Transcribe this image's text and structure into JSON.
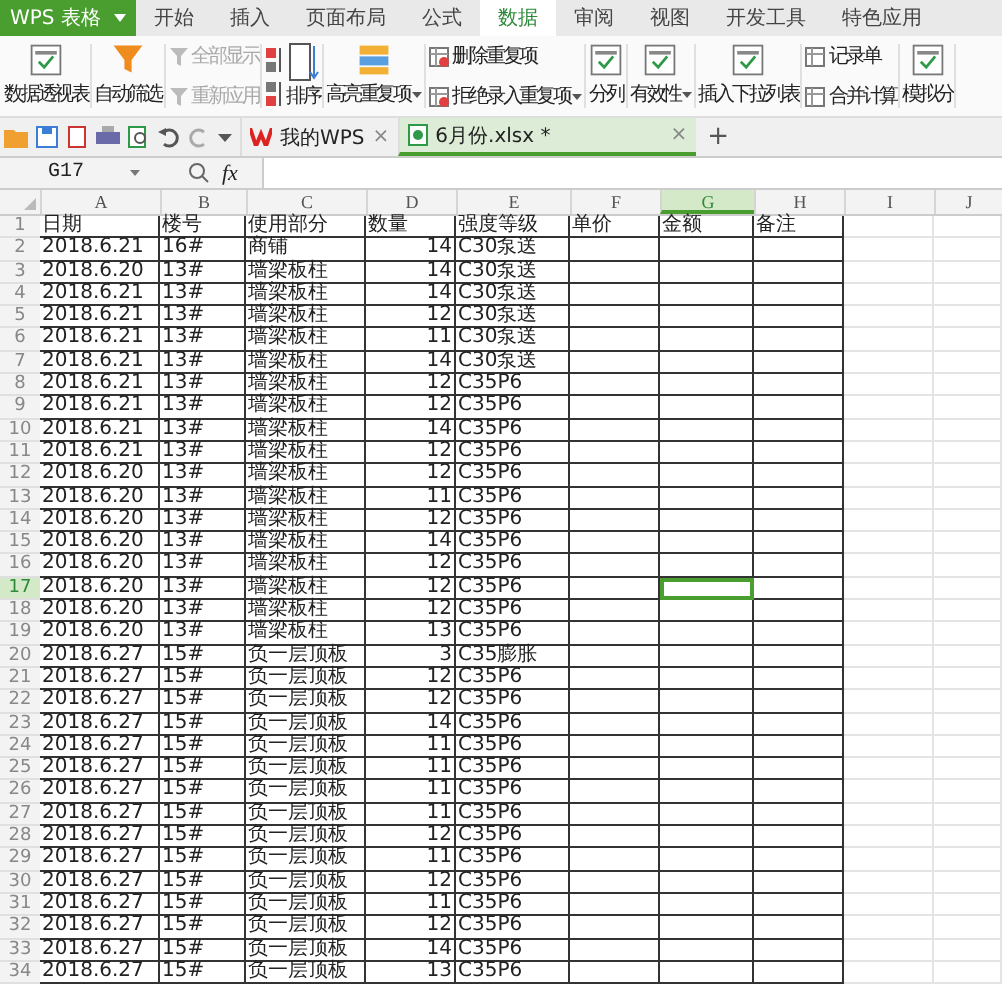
{
  "app": {
    "logo": "WPS 表格"
  },
  "menu_tabs": [
    {
      "label": "开始",
      "selected": false
    },
    {
      "label": "插入",
      "selected": false
    },
    {
      "label": "页面布局",
      "selected": false
    },
    {
      "label": "公式",
      "selected": false
    },
    {
      "label": "数据",
      "selected": true
    },
    {
      "label": "审阅",
      "selected": false
    },
    {
      "label": "视图",
      "selected": false
    },
    {
      "label": "开发工具",
      "selected": false
    },
    {
      "label": "特色应用",
      "selected": false
    }
  ],
  "ribbon": [
    {
      "kind": "large",
      "label": "数据透视表"
    },
    {
      "kind": "large",
      "label": "自动筛选"
    },
    {
      "kind": "stack",
      "items": [
        {
          "label": "全部显示",
          "disabled": true
        },
        {
          "label": "重新应用",
          "disabled": true
        }
      ]
    },
    {
      "kind": "sort",
      "label": "排序"
    },
    {
      "kind": "large",
      "label": "高亮重复项",
      "dropdown": true
    },
    {
      "kind": "stack",
      "items": [
        {
          "label": "删除重复项",
          "disabled": false,
          "dropdown": false
        },
        {
          "label": "拒绝录入重复项",
          "disabled": false,
          "dropdown": true
        }
      ]
    },
    {
      "kind": "large",
      "label": "分列",
      "dropdown": false
    },
    {
      "kind": "large",
      "label": "有效性",
      "dropdown": true
    },
    {
      "kind": "large",
      "label": "插入下拉列表",
      "dropdown": false
    },
    {
      "kind": "stack",
      "items": [
        {
          "label": "记录单",
          "disabled": false
        },
        {
          "label": "合并计算",
          "disabled": false
        }
      ]
    },
    {
      "kind": "large",
      "label": "模拟分"
    }
  ],
  "doc_tabs": [
    {
      "label": "我的WPS",
      "selected": false,
      "close": "×"
    },
    {
      "label": "6月份.xlsx *",
      "selected": true,
      "close": "×"
    }
  ],
  "new_tab": "+",
  "formula_bar": {
    "cell_ref": "G17",
    "fx": "fx"
  },
  "columns": [
    {
      "letter": "A",
      "selected": false
    },
    {
      "letter": "B",
      "selected": false
    },
    {
      "letter": "C",
      "selected": false
    },
    {
      "letter": "D",
      "selected": false
    },
    {
      "letter": "E",
      "selected": false
    },
    {
      "letter": "F",
      "selected": false
    },
    {
      "letter": "G",
      "selected": true
    },
    {
      "letter": "H",
      "selected": false
    },
    {
      "letter": "I",
      "selected": false
    },
    {
      "letter": "J",
      "selected": false
    }
  ],
  "rows": [
    {
      "number": "1",
      "selected": false,
      "cells": [
        "日期",
        "楼号",
        "使用部分",
        "数量",
        "强度等级",
        "单价",
        "金额",
        "备注"
      ]
    },
    {
      "number": "2",
      "selected": false,
      "cells": [
        "2018.6.21",
        "16#",
        "商铺",
        "14",
        "C30泵送"
      ]
    },
    {
      "number": "3",
      "selected": false,
      "cells": [
        "2018.6.20",
        "13#",
        "墙梁板柱",
        "14",
        "C30泵送"
      ]
    },
    {
      "number": "4",
      "selected": false,
      "cells": [
        "2018.6.21",
        "13#",
        "墙梁板柱",
        "14",
        "C30泵送"
      ]
    },
    {
      "number": "5",
      "selected": false,
      "cells": [
        "2018.6.21",
        "13#",
        "墙梁板柱",
        "12",
        "C30泵送"
      ]
    },
    {
      "number": "6",
      "selected": false,
      "cells": [
        "2018.6.21",
        "13#",
        "墙梁板柱",
        "11",
        "C30泵送"
      ]
    },
    {
      "number": "7",
      "selected": false,
      "cells": [
        "2018.6.21",
        "13#",
        "墙梁板柱",
        "14",
        "C30泵送"
      ]
    },
    {
      "number": "8",
      "selected": false,
      "cells": [
        "2018.6.21",
        "13#",
        "墙梁板柱",
        "12",
        "C35P6"
      ]
    },
    {
      "number": "9",
      "selected": false,
      "cells": [
        "2018.6.21",
        "13#",
        "墙梁板柱",
        "12",
        "C35P6"
      ]
    },
    {
      "number": "10",
      "selected": false,
      "cells": [
        "2018.6.21",
        "13#",
        "墙梁板柱",
        "14",
        "C35P6"
      ]
    },
    {
      "number": "11",
      "selected": false,
      "cells": [
        "2018.6.21",
        "13#",
        "墙梁板柱",
        "12",
        "C35P6"
      ]
    },
    {
      "number": "12",
      "selected": false,
      "cells": [
        "2018.6.20",
        "13#",
        "墙梁板柱",
        "12",
        "C35P6"
      ]
    },
    {
      "number": "13",
      "selected": false,
      "cells": [
        "2018.6.20",
        "13#",
        "墙梁板柱",
        "11",
        "C35P6"
      ]
    },
    {
      "number": "14",
      "selected": false,
      "cells": [
        "2018.6.20",
        "13#",
        "墙梁板柱",
        "12",
        "C35P6"
      ]
    },
    {
      "number": "15",
      "selected": false,
      "cells": [
        "2018.6.20",
        "13#",
        "墙梁板柱",
        "14",
        "C35P6"
      ]
    },
    {
      "number": "16",
      "selected": false,
      "cells": [
        "2018.6.20",
        "13#",
        "墙梁板柱",
        "12",
        "C35P6"
      ]
    },
    {
      "number": "17",
      "selected": true,
      "cells": [
        "2018.6.20",
        "13#",
        "墙梁板柱",
        "12",
        "C35P6"
      ]
    },
    {
      "number": "18",
      "selected": false,
      "cells": [
        "2018.6.20",
        "13#",
        "墙梁板柱",
        "12",
        "C35P6"
      ]
    },
    {
      "number": "19",
      "selected": false,
      "cells": [
        "2018.6.20",
        "13#",
        "墙梁板柱",
        "13",
        "C35P6"
      ]
    },
    {
      "number": "20",
      "selected": false,
      "cells": [
        "2018.6.27",
        "15#",
        "负一层顶板",
        "3",
        "C35膨胀"
      ]
    },
    {
      "number": "21",
      "selected": false,
      "cells": [
        "2018.6.27",
        "15#",
        "负一层顶板",
        "12",
        "C35P6"
      ]
    },
    {
      "number": "22",
      "selected": false,
      "cells": [
        "2018.6.27",
        "15#",
        "负一层顶板",
        "12",
        "C35P6"
      ]
    },
    {
      "number": "23",
      "selected": false,
      "cells": [
        "2018.6.27",
        "15#",
        "负一层顶板",
        "14",
        "C35P6"
      ]
    },
    {
      "number": "24",
      "selected": false,
      "cells": [
        "2018.6.27",
        "15#",
        "负一层顶板",
        "11",
        "C35P6"
      ]
    },
    {
      "number": "25",
      "selected": false,
      "cells": [
        "2018.6.27",
        "15#",
        "负一层顶板",
        "11",
        "C35P6"
      ]
    },
    {
      "number": "26",
      "selected": false,
      "cells": [
        "2018.6.27",
        "15#",
        "负一层顶板",
        "11",
        "C35P6"
      ]
    },
    {
      "number": "27",
      "selected": false,
      "cells": [
        "2018.6.27",
        "15#",
        "负一层顶板",
        "11",
        "C35P6"
      ]
    },
    {
      "number": "28",
      "selected": false,
      "cells": [
        "2018.6.27",
        "15#",
        "负一层顶板",
        "12",
        "C35P6"
      ]
    },
    {
      "number": "29",
      "selected": false,
      "cells": [
        "2018.6.27",
        "15#",
        "负一层顶板",
        "11",
        "C35P6"
      ]
    },
    {
      "number": "30",
      "selected": false,
      "cells": [
        "2018.6.27",
        "15#",
        "负一层顶板",
        "12",
        "C35P6"
      ]
    },
    {
      "number": "31",
      "selected": false,
      "cells": [
        "2018.6.27",
        "15#",
        "负一层顶板",
        "11",
        "C35P6"
      ]
    },
    {
      "number": "32",
      "selected": false,
      "cells": [
        "2018.6.27",
        "15#",
        "负一层顶板",
        "12",
        "C35P6"
      ]
    },
    {
      "number": "33",
      "selected": false,
      "cells": [
        "2018.6.27",
        "15#",
        "负一层顶板",
        "14",
        "C35P6"
      ]
    },
    {
      "number": "34",
      "selected": false,
      "cells": [
        "2018.6.27",
        "15#",
        "负一层顶板",
        "13",
        "C35P6"
      ]
    }
  ]
}
